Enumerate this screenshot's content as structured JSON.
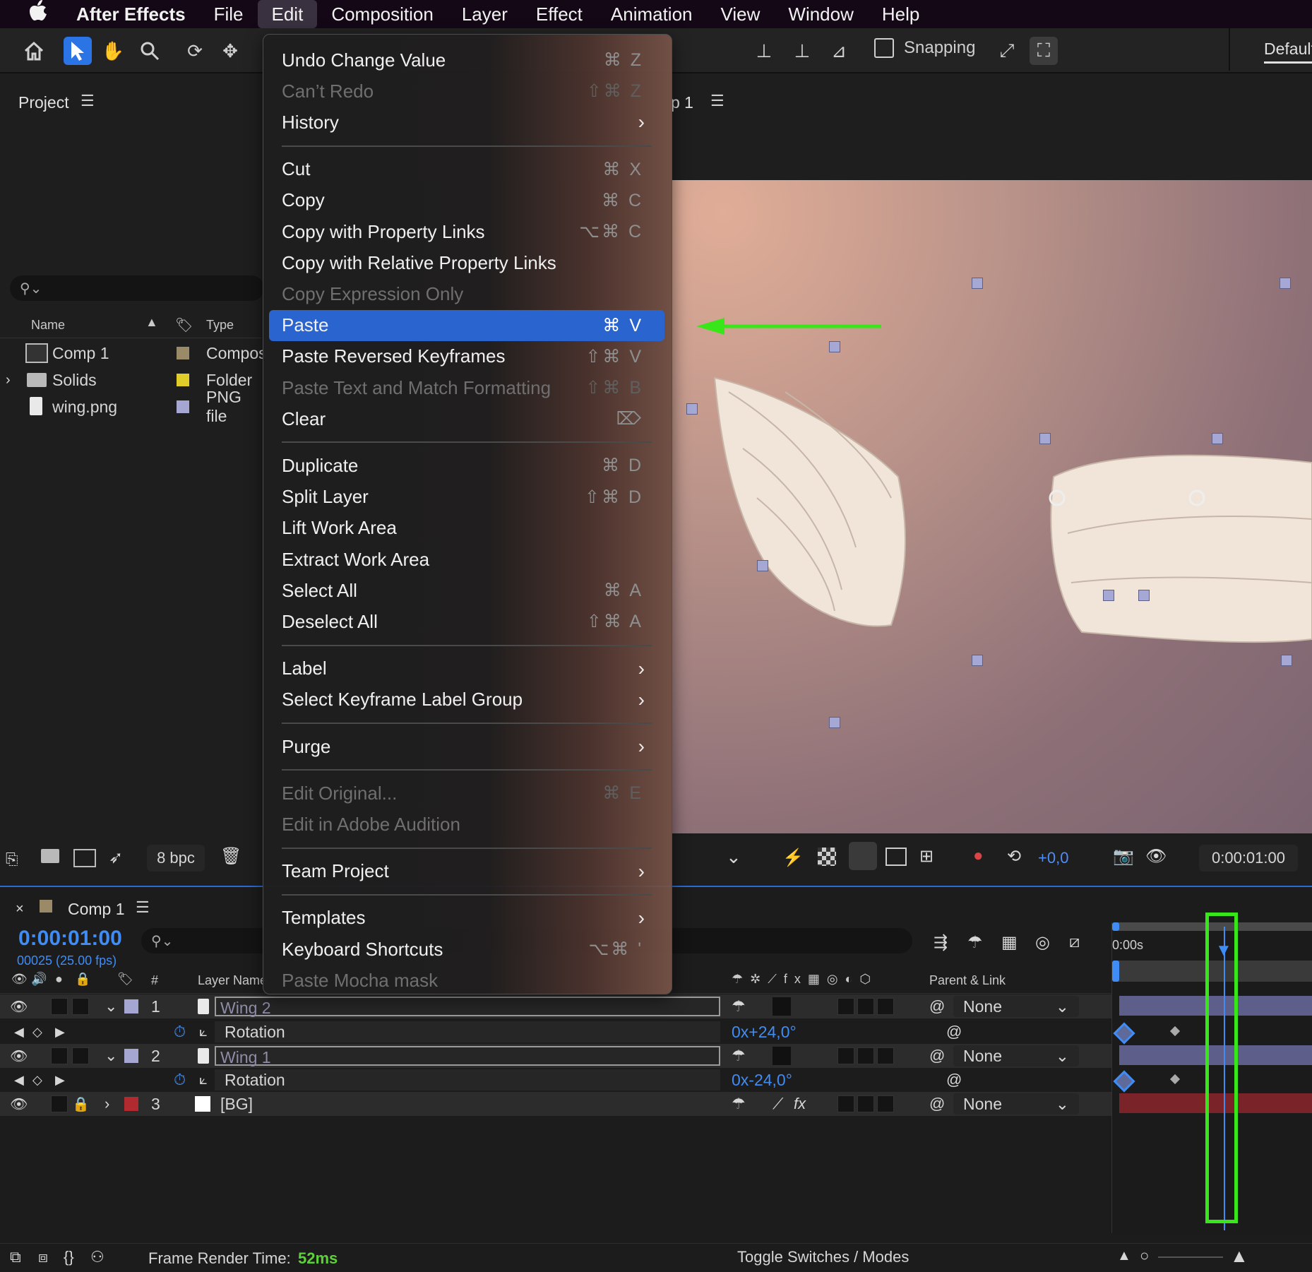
{
  "menubar": {
    "apple": "",
    "items": [
      "After Effects",
      "File",
      "Edit",
      "Composition",
      "Layer",
      "Effect",
      "Animation",
      "View",
      "Window",
      "Help"
    ],
    "active": "Edit"
  },
  "toolbar": {
    "snapping_label": "Snapping",
    "workspace_label": "Default"
  },
  "project_panel": {
    "title": "Project",
    "columns": {
      "name": "Name",
      "type": "Type"
    },
    "items": [
      {
        "name": "Comp 1",
        "type": "Compos",
        "color": "#9b8a68",
        "icon": "composition-icon"
      },
      {
        "name": "Solids",
        "type": "Folder",
        "color": "#e0cd2a",
        "icon": "folder-icon"
      },
      {
        "name": "wing.png",
        "type": "PNG file",
        "color": "#a5a6d2",
        "icon": "file-icon"
      }
    ],
    "bpc": "8 bpc"
  },
  "comp_tab": {
    "label": "p 1"
  },
  "edit_menu": {
    "items": [
      {
        "label": "Undo Change Value",
        "shortcut": "⌘ Z",
        "disabled": false
      },
      {
        "label": "Can’t Redo",
        "shortcut": "⇧⌘ Z",
        "disabled": true
      },
      {
        "label": "History",
        "submenu": true
      },
      {
        "sep": true
      },
      {
        "label": "Cut",
        "shortcut": "⌘ X"
      },
      {
        "label": "Copy",
        "shortcut": "⌘ C"
      },
      {
        "label": "Copy with Property Links",
        "shortcut": "⌥⌘ C"
      },
      {
        "label": "Copy with Relative Property Links"
      },
      {
        "label": "Copy Expression Only",
        "disabled": true
      },
      {
        "label": "Paste",
        "shortcut": "⌘ V",
        "highlighted": true
      },
      {
        "label": "Paste Reversed Keyframes",
        "shortcut": "⇧⌘ V"
      },
      {
        "label": "Paste Text and Match Formatting",
        "shortcut": "⇧⌘ B",
        "disabled": true
      },
      {
        "label": "Clear",
        "shortcut": "⌦"
      },
      {
        "sep": true
      },
      {
        "label": "Duplicate",
        "shortcut": "⌘ D"
      },
      {
        "label": "Split Layer",
        "shortcut": "⇧⌘ D"
      },
      {
        "label": "Lift Work Area"
      },
      {
        "label": "Extract Work Area"
      },
      {
        "label": "Select All",
        "shortcut": "⌘ A"
      },
      {
        "label": "Deselect All",
        "shortcut": "⇧⌘ A"
      },
      {
        "sep": true
      },
      {
        "label": "Label",
        "submenu": true
      },
      {
        "label": "Select Keyframe Label Group",
        "submenu": true
      },
      {
        "sep": true
      },
      {
        "label": "Purge",
        "submenu": true
      },
      {
        "sep": true
      },
      {
        "label": "Edit Original...",
        "shortcut": "⌘ E",
        "disabled": true
      },
      {
        "label": "Edit in Adobe Audition",
        "disabled": true
      },
      {
        "sep": true
      },
      {
        "label": "Team Project",
        "submenu": true
      },
      {
        "sep": true
      },
      {
        "label": "Templates",
        "submenu": true
      },
      {
        "label": "Keyboard Shortcuts",
        "shortcut": "⌥⌘ '"
      },
      {
        "label": "Paste Mocha mask",
        "disabled": true
      }
    ]
  },
  "viewer_bar": {
    "exposure": "+0,0",
    "timecode": "0:00:01:00"
  },
  "timeline": {
    "comp_name": "Comp 1",
    "current_time": "0:00:01:00",
    "frame_info": "00025 (25.00 fps)",
    "columns": {
      "num": "#",
      "layer_name": "Layer Name",
      "parent": "Parent & Link"
    },
    "ruler_start": "0:00s",
    "layers": [
      {
        "num": "1",
        "name": "Wing 2",
        "label_color": "#a5a6d2",
        "parent": "None",
        "property": "Rotation",
        "value": "0x+24,0°"
      },
      {
        "num": "2",
        "name": "Wing 1",
        "label_color": "#a5a6d2",
        "parent": "None",
        "property": "Rotation",
        "value": "0x-24,0°"
      },
      {
        "num": "3",
        "name": "[BG]",
        "label_color": "#b02a30",
        "parent": "None"
      }
    ],
    "status": {
      "render_label": "Frame Render Time:",
      "render_value": "52ms",
      "toggle_label": "Toggle Switches / Modes"
    }
  },
  "colors": {
    "accent_blue": "#2a64cf",
    "annotation_green": "#39e619"
  }
}
